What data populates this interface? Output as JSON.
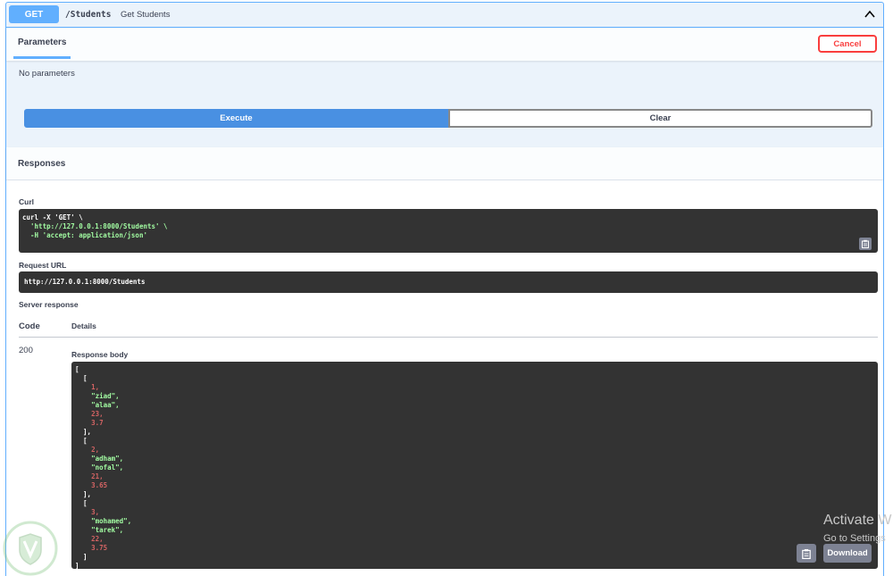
{
  "operation": {
    "method": "GET",
    "path": "/Students",
    "summary": "Get Students"
  },
  "parameters": {
    "tab_label": "Parameters",
    "cancel_label": "Cancel",
    "empty_text": "No parameters"
  },
  "actions": {
    "execute_label": "Execute",
    "clear_label": "Clear"
  },
  "responses": {
    "title": "Responses",
    "curl_label": "Curl",
    "curl_lines": [
      "curl -X 'GET' \\",
      "  'http://127.0.0.1:8000/Students' \\",
      "  -H 'accept: application/json'"
    ],
    "request_url_label": "Request URL",
    "request_url": "http://127.0.0.1:8000/Students",
    "server_response_label": "Server response",
    "code_header": "Code",
    "details_header": "Details",
    "status_code": "200",
    "response_body_label": "Response body",
    "download_label": "Download",
    "body": [
      {
        "id": "1,",
        "first": "\"ziad\",",
        "last": "\"alaa\",",
        "age": "23,",
        "gpa": "3.7"
      },
      {
        "id": "2,",
        "first": "\"adham\",",
        "last": "\"nofal\",",
        "age": "21,",
        "gpa": "3.65"
      },
      {
        "id": "3,",
        "first": "\"mohamed\",",
        "last": "\"tarek\",",
        "age": "22,",
        "gpa": "3.75"
      }
    ]
  },
  "windows_watermark": {
    "line1": "Activate W",
    "line2": "Go to Settings"
  },
  "colors": {
    "get_blue": "#61affe",
    "execute_blue": "#4990e2",
    "cancel_red": "#f93e3e",
    "code_bg": "#333333",
    "string_green": "#a2fca2",
    "number_red": "#d36363"
  },
  "icons": [
    "chevron-up-icon",
    "clipboard-icon",
    "shield-logo-icon"
  ]
}
